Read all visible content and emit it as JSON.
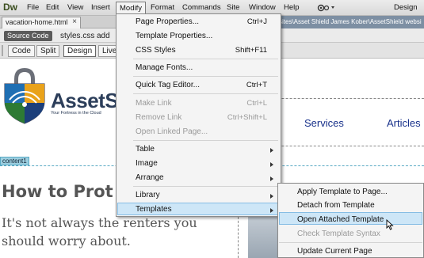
{
  "app": {
    "logo": "Dw",
    "menubar": [
      "File",
      "Edit",
      "View",
      "Insert",
      "Modify",
      "Format",
      "Commands",
      "Site",
      "Window",
      "Help"
    ],
    "active_menu": "Modify",
    "workspace": "Design"
  },
  "doc_tab": {
    "name": "vacation-home.html",
    "close": "×"
  },
  "path": "sites\\Asset Shield James Kober\\AssetShield websi",
  "related_files": {
    "source": "Source Code",
    "files": [
      "styles.css",
      "add"
    ]
  },
  "view_buttons": [
    "Code",
    "Split",
    "Design",
    "Live"
  ],
  "view_selected": "Design",
  "page": {
    "brand": "AssetSh",
    "tagline": "Your Fortress in the Cloud",
    "nav": [
      "Services",
      "Articles"
    ],
    "content_tag": "content1",
    "heading": "How to Prot",
    "paragraph_line1": "It's not always the renters you",
    "paragraph_line2": "should worry about."
  },
  "modify_menu": {
    "items": [
      {
        "label": "Page Properties...",
        "shortcut": "Ctrl+J",
        "disabled": false,
        "submenu": false
      },
      {
        "label": "Template Properties...",
        "shortcut": "",
        "disabled": false,
        "submenu": false
      },
      {
        "label": "CSS Styles",
        "shortcut": "Shift+F11",
        "disabled": false,
        "submenu": false
      },
      {
        "label": "Manage Fonts...",
        "shortcut": "",
        "disabled": false,
        "submenu": false
      },
      {
        "label": "Quick Tag Editor...",
        "shortcut": "Ctrl+T",
        "disabled": false,
        "submenu": false
      },
      {
        "label": "Make Link",
        "shortcut": "Ctrl+L",
        "disabled": true,
        "submenu": false
      },
      {
        "label": "Remove Link",
        "shortcut": "Ctrl+Shift+L",
        "disabled": true,
        "submenu": false
      },
      {
        "label": "Open Linked Page...",
        "shortcut": "",
        "disabled": true,
        "submenu": false
      },
      {
        "label": "Table",
        "shortcut": "",
        "disabled": false,
        "submenu": true
      },
      {
        "label": "Image",
        "shortcut": "",
        "disabled": false,
        "submenu": true
      },
      {
        "label": "Arrange",
        "shortcut": "",
        "disabled": false,
        "submenu": true
      },
      {
        "label": "Library",
        "shortcut": "",
        "disabled": false,
        "submenu": true
      },
      {
        "label": "Templates",
        "shortcut": "",
        "disabled": false,
        "submenu": true,
        "highlighted": true
      }
    ]
  },
  "templates_submenu": {
    "items": [
      {
        "label": "Apply Template to Page...",
        "disabled": false
      },
      {
        "label": "Detach from Template",
        "disabled": false
      },
      {
        "label": "Open Attached Template",
        "disabled": false,
        "highlighted": true
      },
      {
        "label": "Check Template Syntax",
        "disabled": true
      },
      {
        "label": "Update Current Page",
        "disabled": false
      }
    ]
  },
  "colors": {
    "highlight": "#cde6f7",
    "highlight_border": "#86bde4",
    "nav_link": "#17308a",
    "brand": "#2c3e5a",
    "disabled_text": "#9a9a9a"
  }
}
